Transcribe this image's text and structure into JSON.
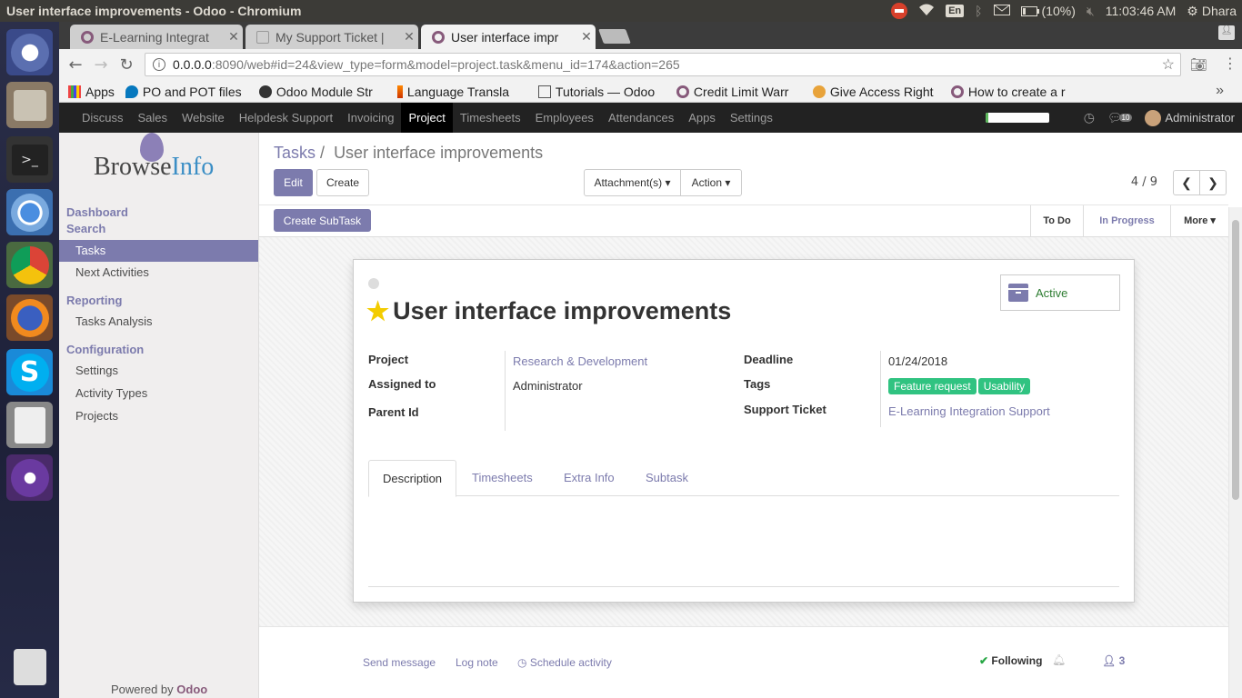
{
  "os": {
    "window_title": "User interface improvements - Odoo - Chromium",
    "keyboard": "En",
    "battery": "(10%)",
    "clock": "11:03:46 AM",
    "user": "Dhara"
  },
  "browser": {
    "tabs": [
      {
        "label": "E-Learning Integrat"
      },
      {
        "label": "My Support Ticket |"
      },
      {
        "label": "User interface impr"
      }
    ],
    "url_host": "0.0.0.0",
    "url_rest": ":8090/web#id=24&view_type=form&model=project.task&menu_id=174&action=265",
    "bookmarks": [
      {
        "label": "Apps"
      },
      {
        "label": "PO and POT files"
      },
      {
        "label": "Odoo Module Str"
      },
      {
        "label": "Language Transla"
      },
      {
        "label": "Tutorials — Odoo"
      },
      {
        "label": "Credit Limit Warr"
      },
      {
        "label": "Give Access Right"
      },
      {
        "label": "How to create a r"
      }
    ],
    "bookmarks_more": "»"
  },
  "odoo_nav": {
    "menu": [
      "Discuss",
      "Sales",
      "Website",
      "Helpdesk Support",
      "Invoicing",
      "Project",
      "Timesheets",
      "Employees",
      "Attendances",
      "Apps",
      "Settings"
    ],
    "active_menu": "Project",
    "progress": 0.05,
    "message_count": "10",
    "user": "Administrator"
  },
  "sidebar": {
    "logo_part1": "Browse",
    "logo_part2": "Info",
    "section_dashboard": "Dashboard",
    "section_search": "Search",
    "items_search": [
      "Tasks",
      "Next Activities"
    ],
    "section_reporting": "Reporting",
    "items_reporting": [
      "Tasks Analysis"
    ],
    "section_configuration": "Configuration",
    "items_configuration": [
      "Settings",
      "Activity Types",
      "Projects"
    ],
    "powered_by": "Powered by",
    "powered_brand": "Odoo"
  },
  "control_panel": {
    "breadcrumb_parent": "Tasks",
    "breadcrumb_sep": "/",
    "breadcrumb_current": "User interface improvements",
    "edit_label": "Edit",
    "create_label": "Create",
    "attachments_label": "Attachment(s) ▾",
    "action_label": "Action ▾",
    "pager": "4 / 9"
  },
  "statusbar": {
    "create_subtask_label": "Create SubTask",
    "stages": [
      "To Do",
      "In Progress",
      "More ▾"
    ],
    "current_stage": "In Progress"
  },
  "form": {
    "title": "User interface improvements",
    "active_label": "Active",
    "fields": {
      "project_label": "Project",
      "project_value": "Research & Development",
      "assigned_label": "Assigned to",
      "assigned_value": "Administrator",
      "parent_label": "Parent Id",
      "deadline_label": "Deadline",
      "deadline_value": "01/24/2018",
      "tags_label": "Tags",
      "tags": [
        "Feature request",
        "Usability"
      ],
      "ticket_label": "Support Ticket",
      "ticket_value": "E-Learning Integration Support"
    },
    "tabs": [
      "Description",
      "Timesheets",
      "Extra Info",
      "Subtask"
    ],
    "active_tab": "Description"
  },
  "chatter": {
    "send_message": "Send message",
    "log_note": "Log note",
    "schedule_activity": "Schedule activity",
    "following": "Following",
    "followers_count": "3"
  },
  "colors": {
    "odoo_purple": "#7c7bad",
    "tag_green": "#30c381",
    "navbar_bg": "#222222"
  }
}
